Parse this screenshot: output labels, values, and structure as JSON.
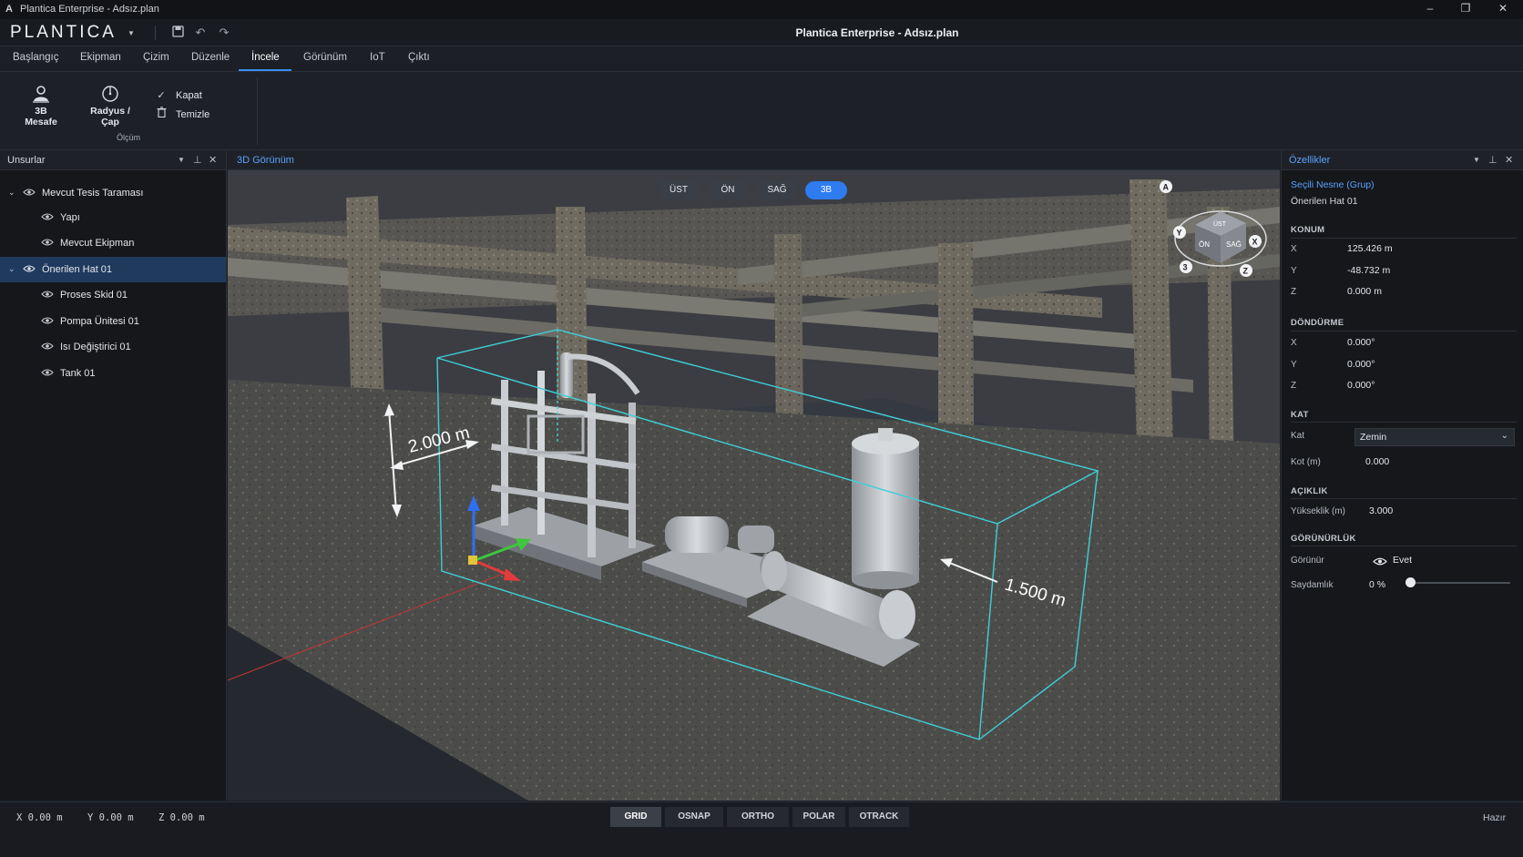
{
  "window": {
    "app_icon": "A",
    "title": "Plantica Enterprise - Adsız.plan"
  },
  "header": {
    "logo": "PLANTICA",
    "document_title": "Plantica Enterprise - Adsız.plan"
  },
  "tabs": [
    {
      "label": "Başlangıç"
    },
    {
      "label": "Ekipman"
    },
    {
      "label": "Çizim"
    },
    {
      "label": "Düzenle"
    },
    {
      "label": "İncele",
      "active": true
    },
    {
      "label": "Görünüm"
    },
    {
      "label": "IoT"
    },
    {
      "label": "Çıktı"
    }
  ],
  "ribbon": {
    "distance_label": "3B Mesafe",
    "radius_label": "Radyus / Çap",
    "close_label": "Kapat",
    "clear_label": "Temizle",
    "group_label": "Ölçüm"
  },
  "left_panel": {
    "title": "Unsurlar",
    "items": [
      {
        "label": "Mevcut Tesis Taraması",
        "expanded": true
      },
      {
        "label": "Yapı"
      },
      {
        "label": "Mevcut Ekipman"
      },
      {
        "label": "Önerilen Hat 01",
        "expanded": true,
        "selected": true
      },
      {
        "label": "Proses Skid 01"
      },
      {
        "label": "Pompa Ünitesi 01"
      },
      {
        "label": "Isı Değiştirici 01"
      },
      {
        "label": "Tank 01"
      }
    ]
  },
  "viewport": {
    "title": "3D Görünüm",
    "view_buttons": [
      {
        "label": "ÜST"
      },
      {
        "label": "ÖN"
      },
      {
        "label": "SAĞ"
      },
      {
        "label": "3B",
        "active": true
      }
    ],
    "dimension_height": "2.000 m",
    "dimension_width": "1.500 m",
    "navcube": {
      "top": "ÜST",
      "front": "ÖN",
      "right": "SAĞ",
      "axis_x": "X",
      "axis_y": "Y",
      "axis_z": "Z",
      "badge": "3",
      "home": "A"
    }
  },
  "properties": {
    "title": "Özellikler",
    "selection_type": "Seçili Nesne (Grup)",
    "selection_name": "Önerilen Hat 01",
    "position": {
      "header": "KONUM",
      "x_label": "X",
      "x": "125.426 m",
      "y_label": "Y",
      "y": "-48.732 m",
      "z_label": "Z",
      "z": "0.000 m"
    },
    "rotation": {
      "header": "DÖNDÜRME",
      "x_label": "X",
      "x": "0.000°",
      "y_label": "Y",
      "y": "0.000°",
      "z_label": "Z",
      "z": "0.000°"
    },
    "floor": {
      "header": "KAT",
      "floor_label": "Kat",
      "floor_value": "Zemin",
      "elevation_label": "Kot (m)",
      "elevation": "0.000"
    },
    "clearance": {
      "header": "AÇIKLIK",
      "height_label": "Yükseklik (m)",
      "height": "3.000"
    },
    "visibility": {
      "header": "GÖRÜNÜRLÜK",
      "visible_label": "Görünür",
      "visible_value": "Evet",
      "transparency_label": "Saydamlık",
      "transparency": "0 %",
      "transparency_fraction": 0
    }
  },
  "status": {
    "x": "X 0.00 m",
    "y": "Y 0.00 m",
    "z": "Z 0.00 m",
    "toggles": [
      {
        "label": "GRID",
        "active": true
      },
      {
        "label": "OSNAP"
      },
      {
        "label": "ORTHO"
      },
      {
        "label": "POLAR"
      },
      {
        "label": "OTRACK"
      }
    ],
    "ready": "Hazır"
  },
  "colors": {
    "accent": "#2f7cf0",
    "selection_box": "#3fd0d8",
    "selected_row": "#203a5e",
    "axis_x": "#e23b3b",
    "axis_y": "#3ec63e",
    "axis_z": "#2f6ff0"
  }
}
